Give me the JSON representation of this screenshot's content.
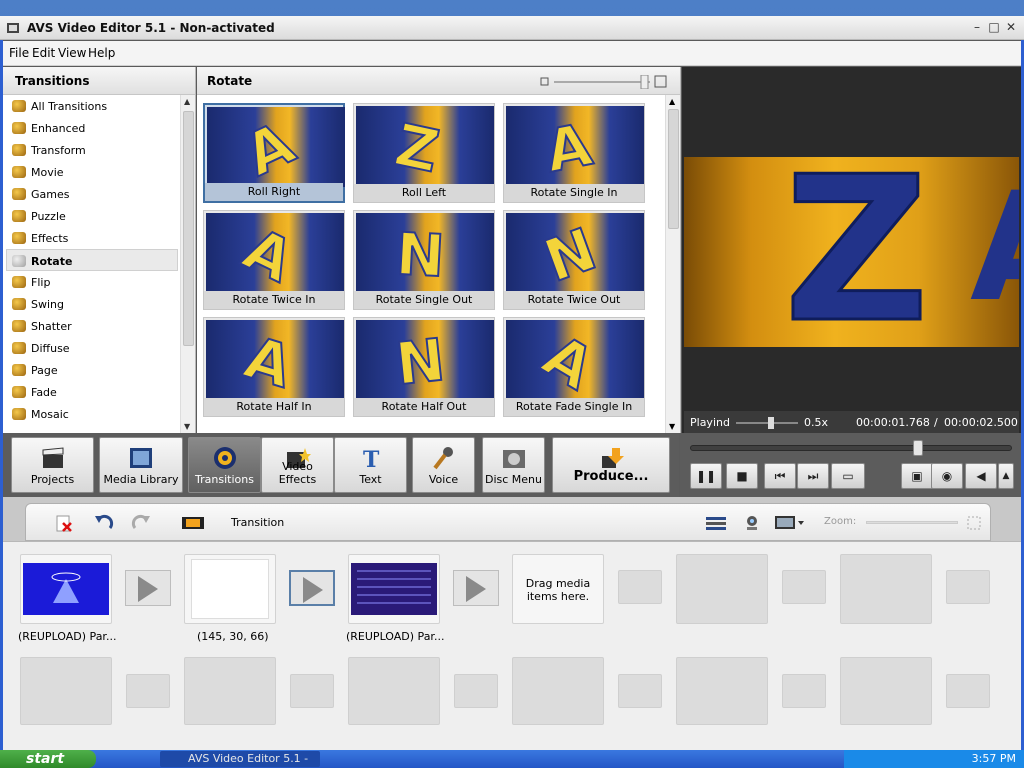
{
  "window": {
    "title": "AVS Video Editor 5.1 - Non-activated"
  },
  "menu": [
    "File",
    "Edit",
    "View",
    "Help"
  ],
  "categories": {
    "header": "Transitions",
    "items": [
      "All Transitions",
      "Enhanced",
      "Transform",
      "Movie",
      "Games",
      "Puzzle",
      "Effects",
      "Rotate",
      "Flip",
      "Swing",
      "Shatter",
      "Diffuse",
      "Page",
      "Fade",
      "Mosaic"
    ],
    "selected": "Rotate"
  },
  "transitions": {
    "header": "Rotate",
    "items": [
      "Roll Right",
      "Roll Left",
      "Rotate Single In",
      "Rotate Twice In",
      "Rotate Single Out",
      "Rotate Twice Out",
      "Rotate Half In",
      "Rotate Half Out",
      "Rotate Fade Single In"
    ],
    "selected": "Roll Right"
  },
  "preview": {
    "playmode": "Playind",
    "speed": "0.5x",
    "current_time": "00:00:01.768",
    "total_time": "00:00:02.500"
  },
  "toolbar": {
    "projects": "Projects",
    "media_library": "Media Library",
    "transitions": "Transitions",
    "video_effects": "Video Effects",
    "text": "Text",
    "voice": "Voice",
    "disc_menu": "Disc Menu",
    "produce": "Produce..."
  },
  "timeline": {
    "mode_label": "Transition",
    "zoom_label": "Zoom:",
    "clips": [
      {
        "caption": "(REUPLOAD) Par..."
      },
      {
        "caption": "(145, 30, 66)"
      },
      {
        "caption": "(REUPLOAD) Par..."
      }
    ],
    "drag_hint": "Drag media items here."
  },
  "taskbar": {
    "start": "start",
    "task": "AVS Video Editor 5.1 -",
    "clock": "3:57 PM"
  },
  "colors": {
    "accent_blue": "#2b3f98",
    "accent_gold": "#f2b726",
    "color_clip": "#ffffff"
  }
}
